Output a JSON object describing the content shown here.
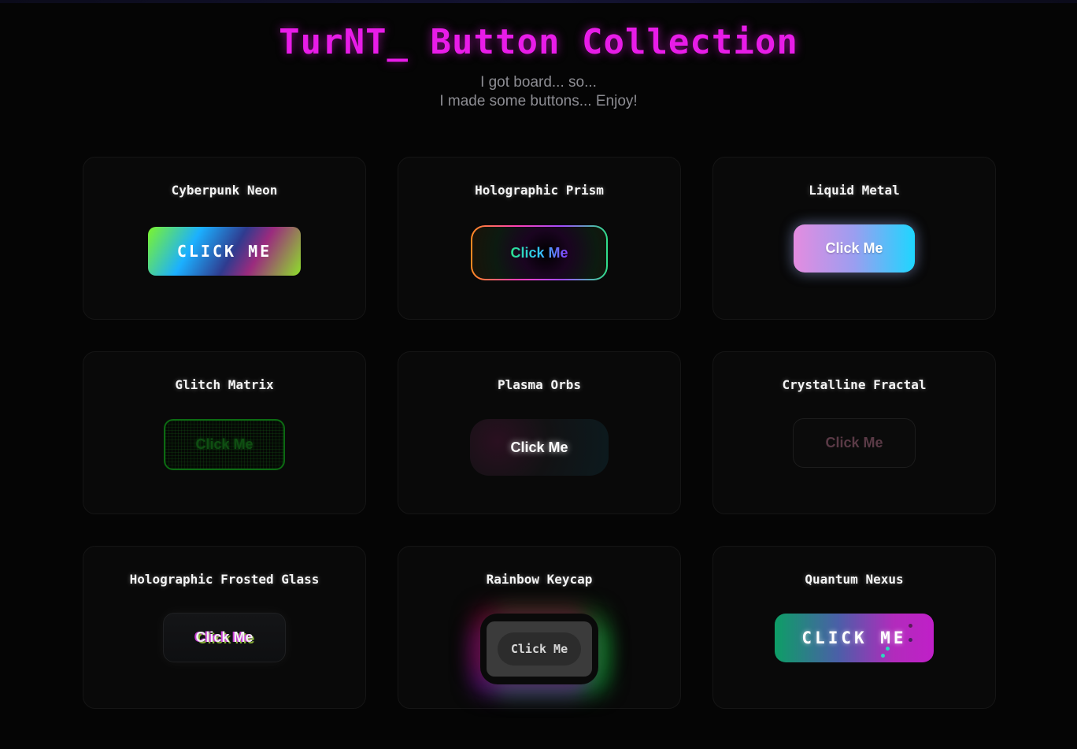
{
  "header": {
    "title": "TurNT_ Button Collection",
    "subtitle_line1": "I got board... so...",
    "subtitle_line2": "I made some buttons... Enjoy!"
  },
  "cards": [
    {
      "title": "Cyberpunk Neon",
      "button_label": "CLICK ME"
    },
    {
      "title": "Holographic Prism",
      "button_label": "Click Me"
    },
    {
      "title": "Liquid Metal",
      "button_label": "Click Me"
    },
    {
      "title": "Glitch Matrix",
      "button_label": "Click Me"
    },
    {
      "title": "Plasma Orbs",
      "button_label": "Click Me"
    },
    {
      "title": "Crystalline Fractal",
      "button_label": "Click Me"
    },
    {
      "title": "Holographic Frosted Glass",
      "button_label": "Click Me"
    },
    {
      "title": "Rainbow Keycap",
      "button_label": "Click Me"
    },
    {
      "title": "Quantum Nexus",
      "button_label": "CLICK ME"
    }
  ],
  "colors": {
    "background": "#050505",
    "title_magenta": "#e81ce8",
    "subtitle_gray": "#8d8d93",
    "card_background": "#090909"
  }
}
